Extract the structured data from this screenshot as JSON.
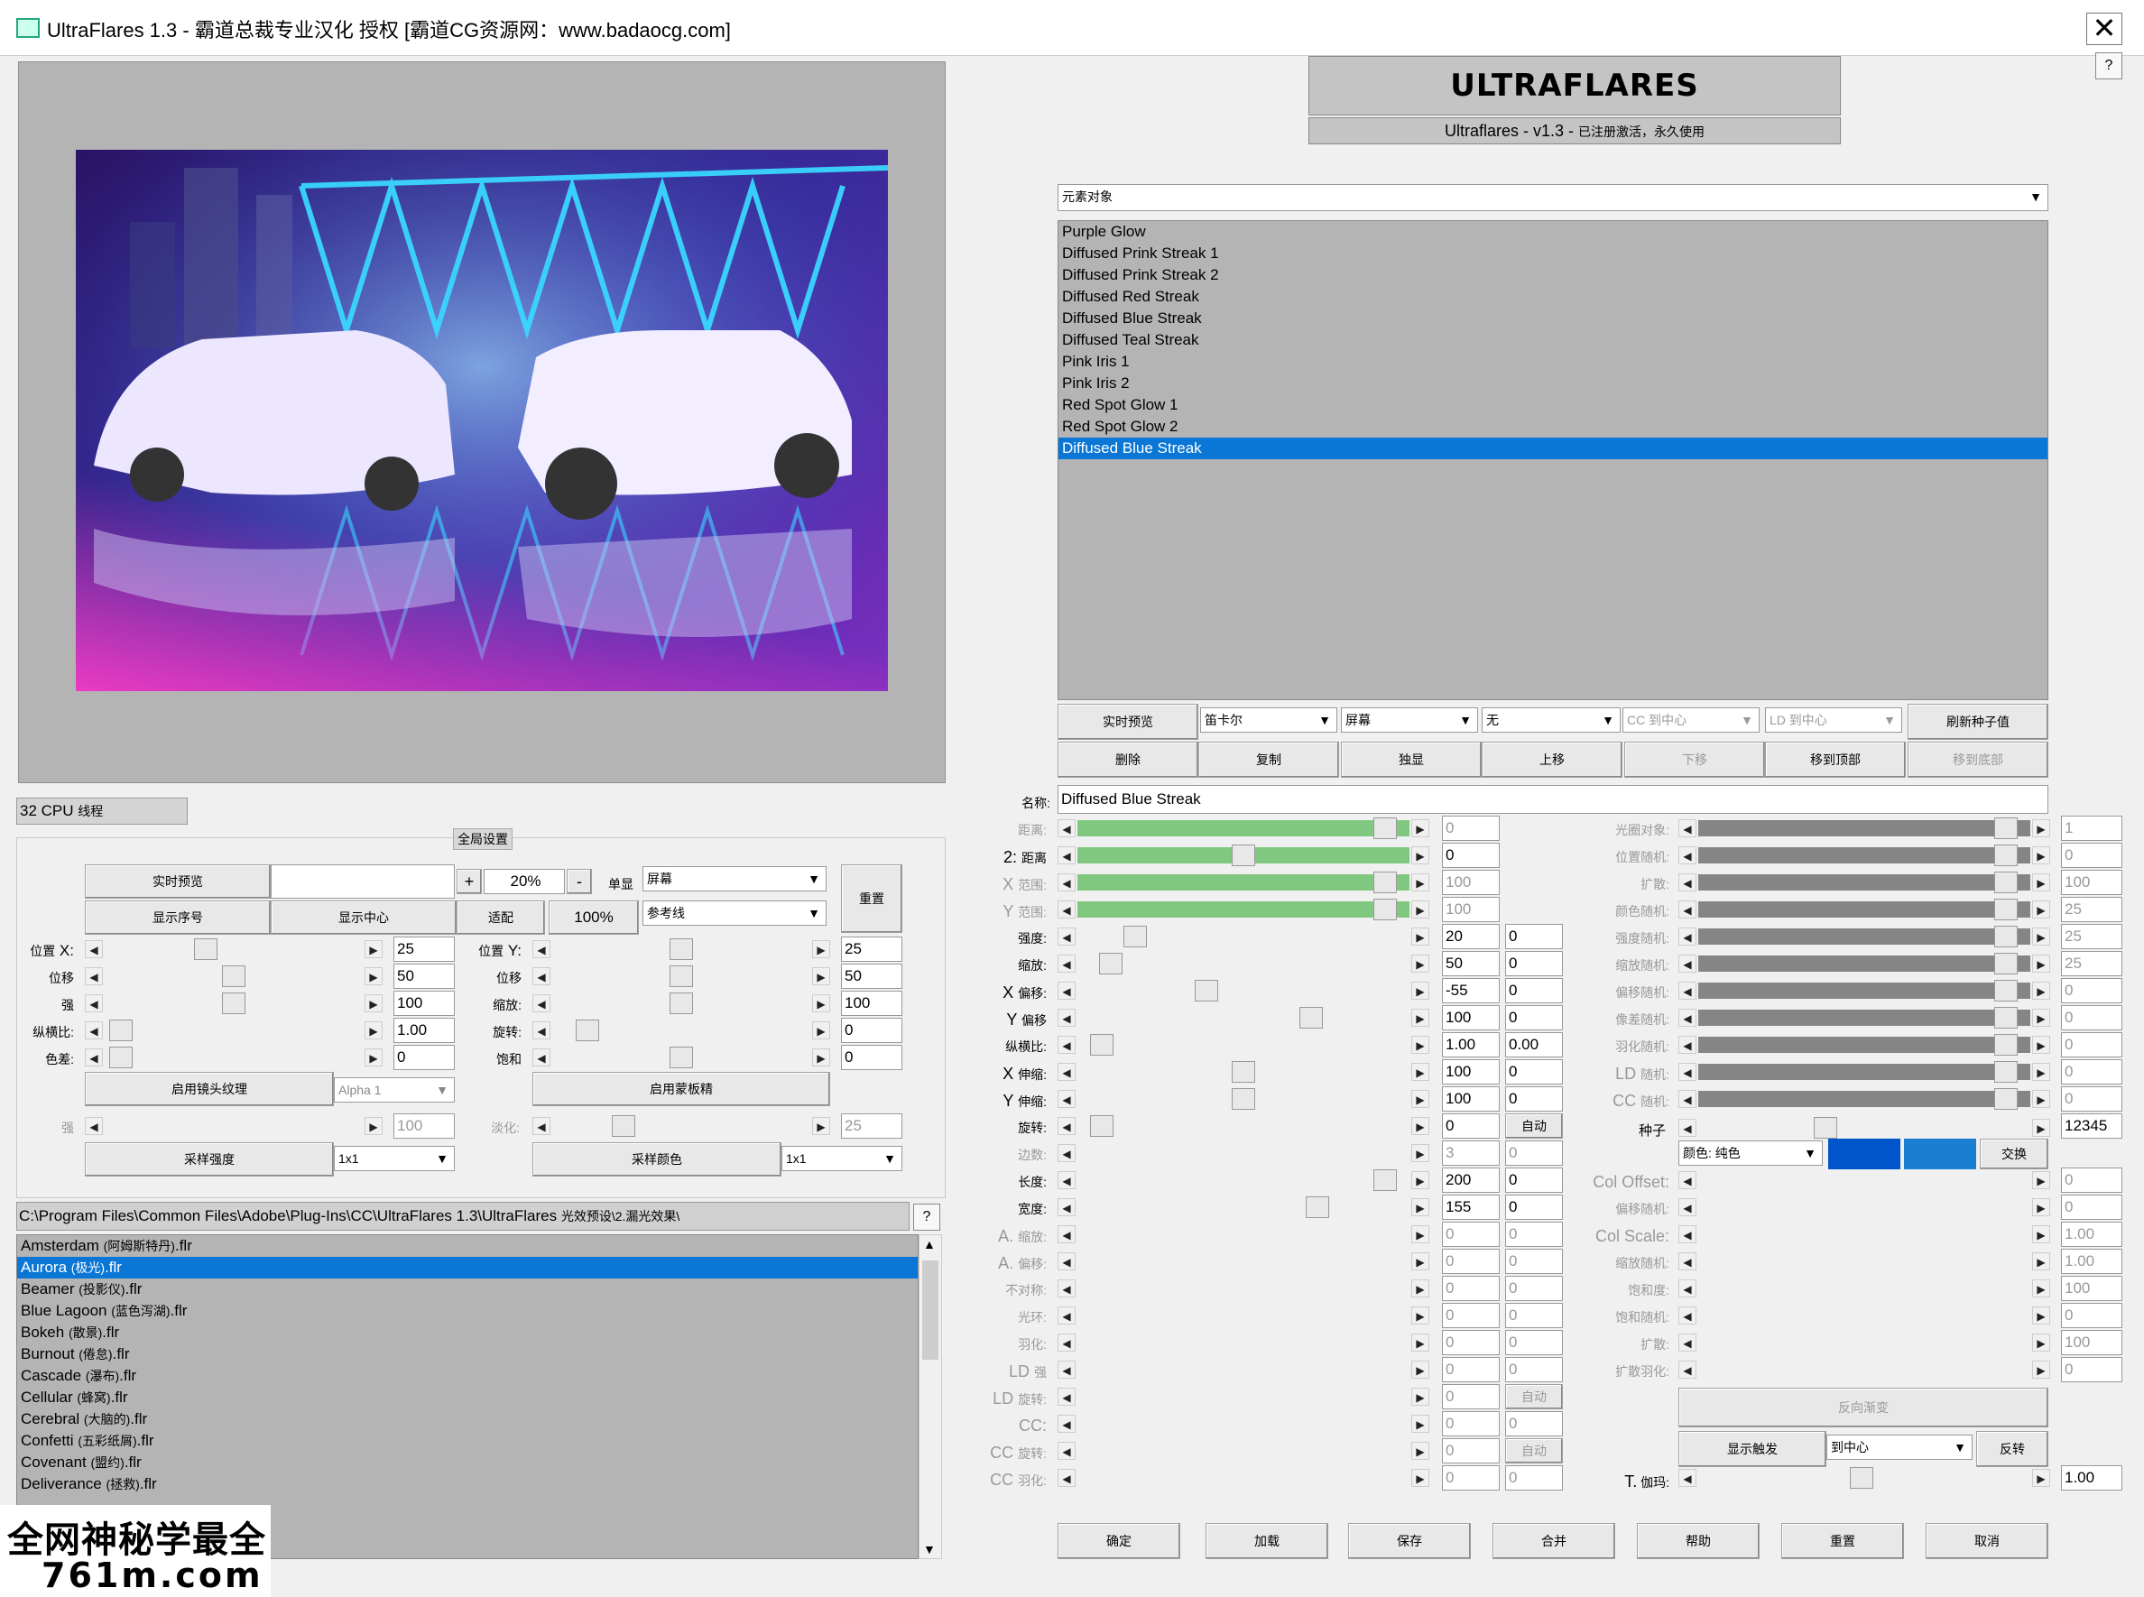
{
  "window": {
    "title": "UltraFlares 1.3 - 霸道总裁专业汉化 授权 [霸道CG资源网：www.badaocg.com]",
    "close": "✕",
    "help": "?"
  },
  "banner": {
    "logo": "ULTRAFLARES",
    "version_main": "Ultraflares - v1.3 -",
    "version_note": "已注册激活，永久使用"
  },
  "cpu": {
    "count": "32 CPU",
    "unit": "线程"
  },
  "global": {
    "title": "全局设置",
    "live_preview": "实时预览",
    "plus": "+",
    "zoom": "20%",
    "minus": "-",
    "single": "单显",
    "mode": "屏幕",
    "reset": "重置",
    "show_index": "显示序号",
    "show_center": "显示中心",
    "fit": "适配",
    "hundred": "100%",
    "guide": "参考线",
    "rows_left": [
      {
        "label": "位置",
        "label_big": "X:",
        "value": "25",
        "thumb": 0.38
      },
      {
        "label": "位移",
        "label_big": "",
        "value": "50",
        "thumb": 0.5
      },
      {
        "label": "强",
        "label_big": "",
        "value": "100",
        "thumb": 0.5
      },
      {
        "label": "纵横比:",
        "label_big": "",
        "value": "1.00",
        "thumb": 0.02
      },
      {
        "label": "色差:",
        "label_big": "",
        "value": "0",
        "thumb": 0.02
      }
    ],
    "rows_right": [
      {
        "label": "位置",
        "label_big": "Y:",
        "value": "25",
        "thumb": 0.5
      },
      {
        "label": "位移",
        "label_big": "",
        "value": "50",
        "thumb": 0.5
      },
      {
        "label": "缩放:",
        "label_big": "",
        "value": "100",
        "thumb": 0.5
      },
      {
        "label": "旋转:",
        "label_big": "",
        "value": "0",
        "thumb": 0.1
      },
      {
        "label": "饱和",
        "label_big": "",
        "value": "0",
        "thumb": 0.5
      }
    ],
    "lens_texture": "启用镜头纹理",
    "alpha": "Alpha 1",
    "mask": "启用蒙板精",
    "strength_label": "强",
    "strength_value": "100",
    "fade_label": "淡化:",
    "fade_value": "25",
    "sample_strength": "采样强度",
    "sample_strength_val": "1x1",
    "sample_color": "采样颜色",
    "sample_color_val": "1x1"
  },
  "preset_path": {
    "path": "C:\\Program Files\\Common Files\\Adobe\\Plug-Ins\\CC\\UltraFlares 1.3\\UltraFlares ",
    "path_cn": "光效预设\\2.漏光效果\\",
    "help": "?"
  },
  "presets": [
    {
      "name": "Amsterdam ",
      "cn": "(阿姆斯特丹)",
      "ext": ".flr",
      "selected": false
    },
    {
      "name": "Aurora ",
      "cn": "(极光)",
      "ext": ".flr",
      "selected": true
    },
    {
      "name": "Beamer ",
      "cn": "(投影仪)",
      "ext": ".flr",
      "selected": false
    },
    {
      "name": "Blue Lagoon ",
      "cn": "(蓝色泻湖)",
      "ext": ".flr",
      "selected": false
    },
    {
      "name": "Bokeh ",
      "cn": "(散景)",
      "ext": ".flr",
      "selected": false
    },
    {
      "name": "Burnout ",
      "cn": "(倦怠)",
      "ext": ".flr",
      "selected": false
    },
    {
      "name": "Cascade ",
      "cn": "(瀑布)",
      "ext": ".flr",
      "selected": false
    },
    {
      "name": "Cellular ",
      "cn": "(蜂窝)",
      "ext": ".flr",
      "selected": false
    },
    {
      "name": "Cerebral ",
      "cn": "(大脑的)",
      "ext": ".flr",
      "selected": false
    },
    {
      "name": "Confetti ",
      "cn": "(五彩纸屑)",
      "ext": ".flr",
      "selected": false
    },
    {
      "name": "Covenant ",
      "cn": "(盟约)",
      "ext": ".flr",
      "selected": false
    },
    {
      "name": "Deliverance ",
      "cn": "(拯救)",
      "ext": ".flr",
      "selected": false
    }
  ],
  "element_type": "元素对象",
  "elements": [
    {
      "name": "Purple Glow",
      "selected": false
    },
    {
      "name": "Diffused Prink Streak 1",
      "selected": false
    },
    {
      "name": "Diffused Prink Streak 2",
      "selected": false
    },
    {
      "name": "Diffused Red Streak",
      "selected": false
    },
    {
      "name": "Diffused Blue Streak",
      "selected": false
    },
    {
      "name": "Diffused Teal Streak",
      "selected": false
    },
    {
      "name": "Pink Iris 1",
      "selected": false
    },
    {
      "name": "Pink Iris 2",
      "selected": false
    },
    {
      "name": "Red Spot Glow 1",
      "selected": false
    },
    {
      "name": "Red Spot Glow 2",
      "selected": false
    },
    {
      "name": "Diffused Blue Streak",
      "selected": true
    }
  ],
  "toolbar1": {
    "live": "实时预览",
    "d1": "笛卡尔",
    "d2": "屏幕",
    "d3": "无",
    "d4": "CC 到中心",
    "d5": "LD 到中心",
    "refresh_seed": "刷新种子值"
  },
  "toolbar2": {
    "delete": "删除",
    "copy": "复制",
    "solo": "独显",
    "up": "上移",
    "down": "下移",
    "top": "移到顶部",
    "bottom": "移到底部"
  },
  "name": {
    "label": "名称:",
    "value": "Diffused Blue Streak"
  },
  "params_left": [
    {
      "label": "距离:",
      "big": "",
      "v1": "0",
      "v2": "",
      "track": "green",
      "thumb": 0.96,
      "dis": true,
      "extra": ""
    },
    {
      "label": "距离",
      "big": "2:",
      "v1": "0",
      "v2": "",
      "track": "green",
      "thumb": 0.5,
      "dis": false,
      "extra": ""
    },
    {
      "label": "范围:",
      "big": "X",
      "v1": "100",
      "v2": "",
      "track": "green",
      "thumb": 0.96,
      "dis": true,
      "extra": ""
    },
    {
      "label": "范围:",
      "big": "Y",
      "v1": "100",
      "v2": "",
      "track": "green",
      "thumb": 0.96,
      "dis": true,
      "extra": ""
    },
    {
      "label": "强度:",
      "big": "",
      "v1": "20",
      "v2": "0",
      "track": "",
      "thumb": 0.15,
      "dis": false,
      "extra": ""
    },
    {
      "label": "缩放:",
      "big": "",
      "v1": "50",
      "v2": "0",
      "track": "",
      "thumb": 0.07,
      "dis": false,
      "extra": ""
    },
    {
      "label": "偏移:",
      "big": "X",
      "v1": "-55",
      "v2": "0",
      "track": "",
      "thumb": 0.38,
      "dis": false,
      "extra": ""
    },
    {
      "label": "偏移",
      "big": "Y",
      "v1": "100",
      "v2": "0",
      "track": "",
      "thumb": 0.72,
      "dis": false,
      "extra": ""
    },
    {
      "label": "纵横比:",
      "big": "",
      "v1": "1.00",
      "v2": "0.00",
      "track": "",
      "thumb": 0.04,
      "dis": false,
      "extra": ""
    },
    {
      "label": "伸缩:",
      "big": "X",
      "v1": "100",
      "v2": "0",
      "track": "",
      "thumb": 0.5,
      "dis": false,
      "extra": ""
    },
    {
      "label": "伸缩:",
      "big": "Y",
      "v1": "100",
      "v2": "0",
      "track": "",
      "thumb": 0.5,
      "dis": false,
      "extra": ""
    },
    {
      "label": "旋转:",
      "big": "",
      "v1": "0",
      "v2": "",
      "track": "",
      "thumb": 0.04,
      "dis": false,
      "extra": "自动"
    },
    {
      "label": "边数:",
      "big": "",
      "v1": "3",
      "v2": "0",
      "track": "",
      "thumb": -1,
      "dis": true,
      "extra": ""
    },
    {
      "label": "长度:",
      "big": "",
      "v1": "200",
      "v2": "0",
      "track": "",
      "thumb": 0.96,
      "dis": false,
      "extra": ""
    },
    {
      "label": "宽度:",
      "big": "",
      "v1": "155",
      "v2": "0",
      "track": "",
      "thumb": 0.74,
      "dis": false,
      "extra": ""
    },
    {
      "label": "缩放:",
      "big": "A.",
      "v1": "0",
      "v2": "0",
      "track": "",
      "thumb": -1,
      "dis": true,
      "extra": ""
    },
    {
      "label": "偏移:",
      "big": "A.",
      "v1": "0",
      "v2": "0",
      "track": "",
      "thumb": -1,
      "dis": true,
      "extra": ""
    },
    {
      "label": "不对称:",
      "big": "",
      "v1": "0",
      "v2": "0",
      "track": "",
      "thumb": -1,
      "dis": true,
      "extra": ""
    },
    {
      "label": "光环:",
      "big": "",
      "v1": "0",
      "v2": "0",
      "track": "",
      "thumb": -1,
      "dis": true,
      "extra": ""
    },
    {
      "label": "羽化:",
      "big": "",
      "v1": "0",
      "v2": "0",
      "track": "",
      "thumb": -1,
      "dis": true,
      "extra": ""
    },
    {
      "label": "强",
      "big": "LD",
      "v1": "0",
      "v2": "0",
      "track": "",
      "thumb": -1,
      "dis": true,
      "extra": ""
    },
    {
      "label": "旋转:",
      "big": "LD",
      "v1": "0",
      "v2": "",
      "track": "",
      "thumb": -1,
      "dis": true,
      "extra": "自动"
    },
    {
      "label": "",
      "big": "CC:",
      "v1": "0",
      "v2": "0",
      "track": "",
      "thumb": -1,
      "dis": true,
      "extra": ""
    },
    {
      "label": "旋转:",
      "big": "CC",
      "v1": "0",
      "v2": "",
      "track": "",
      "thumb": -1,
      "dis": true,
      "extra": "自动"
    },
    {
      "label": "羽化:",
      "big": "CC",
      "v1": "0",
      "v2": "0",
      "track": "",
      "thumb": -1,
      "dis": true,
      "extra": ""
    }
  ],
  "params_right": [
    {
      "label": "光圈对象:",
      "big": "",
      "v": "1",
      "track": "grey",
      "dis": true
    },
    {
      "label": "位置随机:",
      "big": "",
      "v": "0",
      "track": "grey",
      "dis": true
    },
    {
      "label": "扩散:",
      "big": "",
      "v": "100",
      "track": "grey",
      "dis": true
    },
    {
      "label": "颜色随机:",
      "big": "",
      "v": "25",
      "track": "grey",
      "dis": true
    },
    {
      "label": "强度随机:",
      "big": "",
      "v": "25",
      "track": "grey",
      "dis": true
    },
    {
      "label": "缩放随机:",
      "big": "",
      "v": "25",
      "track": "grey",
      "dis": true
    },
    {
      "label": "偏移随机:",
      "big": "",
      "v": "0",
      "track": "grey",
      "dis": true
    },
    {
      "label": "像差随机:",
      "big": "",
      "v": "0",
      "track": "grey",
      "dis": true
    },
    {
      "label": "羽化随机:",
      "big": "",
      "v": "0",
      "track": "grey",
      "dis": true
    },
    {
      "label": "随机:",
      "big": "LD",
      "v": "0",
      "track": "grey",
      "dis": true
    },
    {
      "label": "随机:",
      "big": "CC",
      "v": "0",
      "track": "grey",
      "dis": true
    }
  ],
  "seed": {
    "label": "种子",
    "value": "12345"
  },
  "color": {
    "mode": "颜色: 纯色",
    "swatch1": "#0055cc",
    "swatch2": "#1a7fd0",
    "swap": "交换"
  },
  "params_right2": [
    {
      "label": "",
      "big": "Col Offset:",
      "v": "0"
    },
    {
      "label": "偏移随机:",
      "big": "",
      "v": "0"
    },
    {
      "label": "",
      "big": "Col Scale:",
      "v": "1.00"
    },
    {
      "label": "缩放随机:",
      "big": "",
      "v": "1.00"
    },
    {
      "label": "饱和度:",
      "big": "",
      "v": "100"
    },
    {
      "label": "饱和随机:",
      "big": "",
      "v": "0"
    },
    {
      "label": "扩散:",
      "big": "",
      "v": "100"
    },
    {
      "label": "扩散羽化:",
      "big": "",
      "v": "0"
    }
  ],
  "reverse_gradient": "反向渐变",
  "show_trigger": "显示触发",
  "to_center": "到中心",
  "reverse": "反转",
  "gamma": {
    "big": "T.",
    "label": "伽玛:",
    "value": "1.00"
  },
  "bottom_buttons": {
    "ok": "确定",
    "load": "加载",
    "save": "保存",
    "merge": "合并",
    "help": "帮助",
    "reset": "重置",
    "cancel": "取消"
  },
  "watermark": {
    "line1": "全网神秘学最全",
    "line2": "761m.com"
  }
}
